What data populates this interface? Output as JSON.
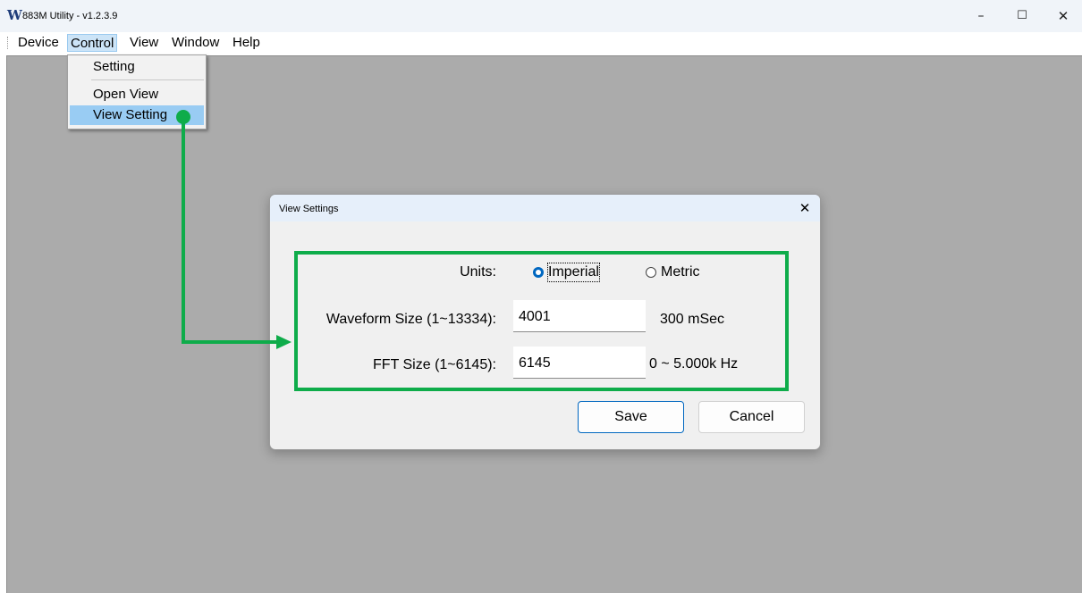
{
  "window": {
    "logo": "W",
    "title": "883M Utility - v1.2.3.9",
    "controls": {
      "minimize": "–",
      "maximize": "☐",
      "close": "✕"
    }
  },
  "menubar": {
    "items": [
      "Device",
      "Control",
      "View",
      "Window",
      "Help"
    ],
    "active": "Control"
  },
  "control_menu": {
    "items": [
      "Setting",
      "Open View",
      "View Setting"
    ],
    "highlighted": "View Setting"
  },
  "dialog": {
    "title": "View Settings",
    "close": "✕",
    "units": {
      "label": "Units:",
      "options": [
        "Imperial",
        "Metric"
      ],
      "selected": "Imperial"
    },
    "waveform": {
      "label": "Waveform Size (1~13334):",
      "value": "4001",
      "readout": "300 mSec"
    },
    "fft": {
      "label": "FFT Size (1~6145):",
      "value": "6145",
      "readout": "0 ~ 5.000k Hz"
    },
    "buttons": {
      "save": "Save",
      "cancel": "Cancel"
    }
  },
  "colors": {
    "annotation_green": "#0eac4a",
    "menu_highlight": "#99ccf3",
    "workspace": "#ababab",
    "radio_accent": "#0067c0"
  }
}
